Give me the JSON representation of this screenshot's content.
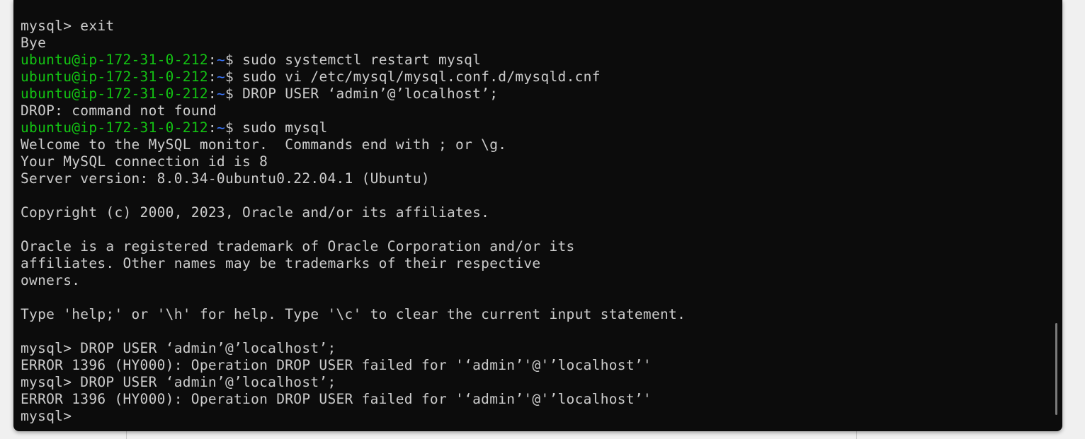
{
  "terminal": {
    "lines": [
      {
        "type": "plain",
        "text": "mysql> exit"
      },
      {
        "type": "plain",
        "text": "Bye"
      },
      {
        "type": "prompt",
        "user": "ubuntu@ip-172-31-0-212",
        "sep": ":",
        "path": "~",
        "symbol": "$ ",
        "cmd": "sudo systemctl restart mysql"
      },
      {
        "type": "prompt",
        "user": "ubuntu@ip-172-31-0-212",
        "sep": ":",
        "path": "~",
        "symbol": "$ ",
        "cmd": "sudo vi /etc/mysql/mysql.conf.d/mysqld.cnf"
      },
      {
        "type": "prompt",
        "user": "ubuntu@ip-172-31-0-212",
        "sep": ":",
        "path": "~",
        "symbol": "$ ",
        "cmd": "DROP USER ‘admin’@’localhost’;"
      },
      {
        "type": "plain",
        "text": "DROP: command not found"
      },
      {
        "type": "prompt",
        "user": "ubuntu@ip-172-31-0-212",
        "sep": ":",
        "path": "~",
        "symbol": "$ ",
        "cmd": "sudo mysql"
      },
      {
        "type": "plain",
        "text": "Welcome to the MySQL monitor.  Commands end with ; or \\g."
      },
      {
        "type": "plain",
        "text": "Your MySQL connection id is 8"
      },
      {
        "type": "plain",
        "text": "Server version: 8.0.34-0ubuntu0.22.04.1 (Ubuntu)"
      },
      {
        "type": "plain",
        "text": ""
      },
      {
        "type": "plain",
        "text": "Copyright (c) 2000, 2023, Oracle and/or its affiliates."
      },
      {
        "type": "plain",
        "text": ""
      },
      {
        "type": "plain",
        "text": "Oracle is a registered trademark of Oracle Corporation and/or its"
      },
      {
        "type": "plain",
        "text": "affiliates. Other names may be trademarks of their respective"
      },
      {
        "type": "plain",
        "text": "owners."
      },
      {
        "type": "plain",
        "text": ""
      },
      {
        "type": "plain",
        "text": "Type 'help;' or '\\h' for help. Type '\\c' to clear the current input statement."
      },
      {
        "type": "plain",
        "text": ""
      },
      {
        "type": "plain",
        "text": "mysql> DROP USER ‘admin’@’localhost’;"
      },
      {
        "type": "plain",
        "text": "ERROR 1396 (HY000): Operation DROP USER failed for '‘admin’'@'’localhost’'"
      },
      {
        "type": "plain",
        "text": "mysql> DROP USER ‘admin’@’localhost’;"
      },
      {
        "type": "plain",
        "text": "ERROR 1396 (HY000): Operation DROP USER failed for '‘admin’'@'’localhost’'"
      },
      {
        "type": "plain",
        "text": "mysql> "
      }
    ]
  },
  "colors": {
    "background": "#0c0c0c",
    "text": "#cccccc",
    "user": "#13c313",
    "path": "#3b78ff"
  }
}
